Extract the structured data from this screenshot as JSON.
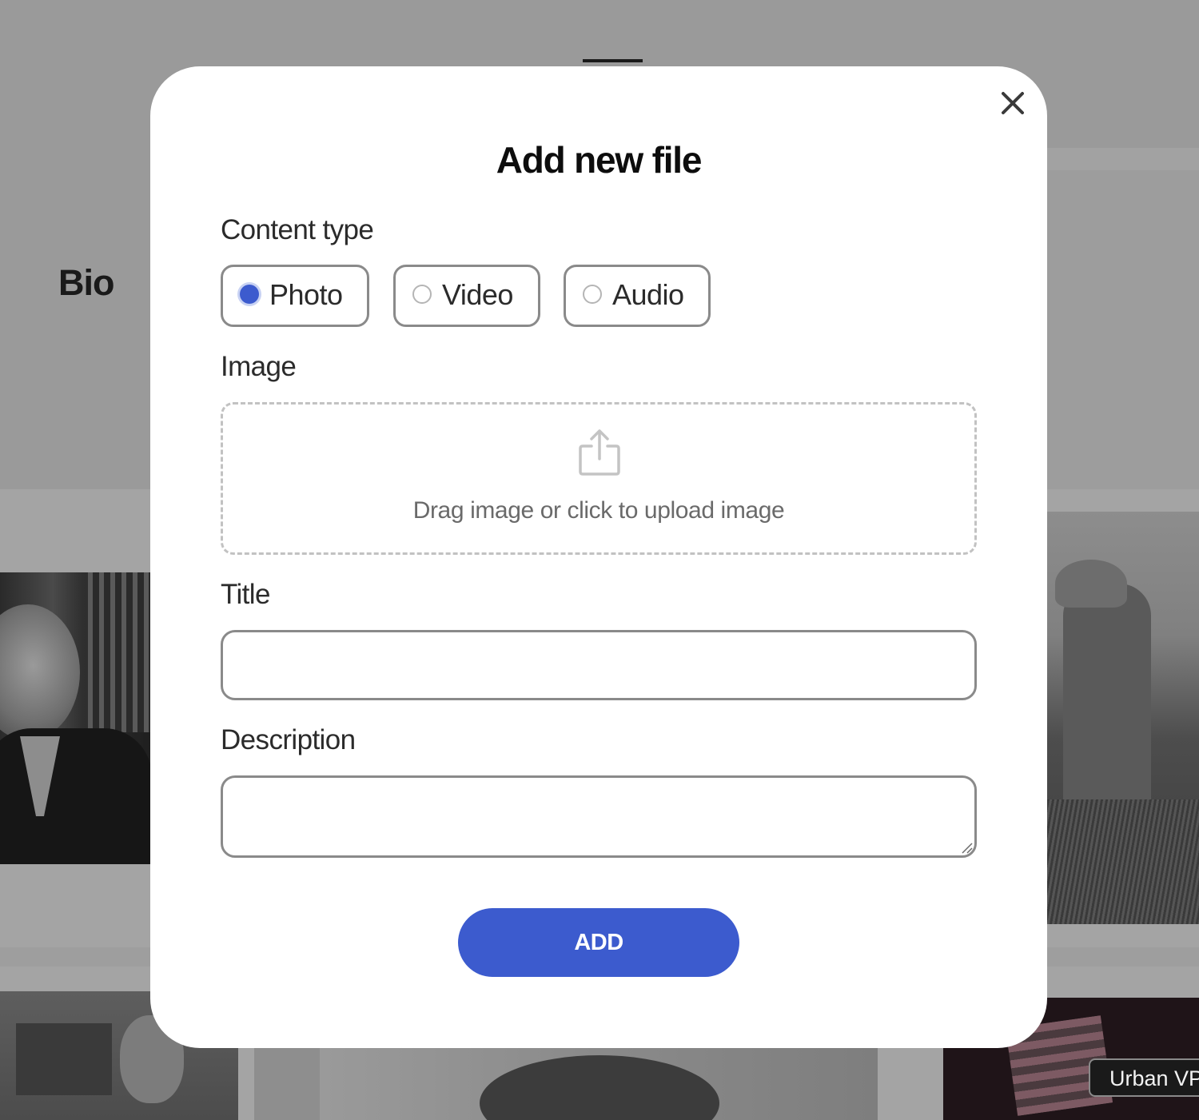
{
  "background": {
    "section_heading": "Bio",
    "photo_tag": "Urban VP"
  },
  "modal": {
    "title": "Add new file",
    "close_icon": "close-icon",
    "content_type": {
      "label": "Content type",
      "options": [
        {
          "label": "Photo",
          "selected": true
        },
        {
          "label": "Video",
          "selected": false
        },
        {
          "label": "Audio",
          "selected": false
        }
      ]
    },
    "image": {
      "label": "Image",
      "upload_icon": "upload-icon",
      "dropzone_text": "Drag image or click to upload image"
    },
    "title_field": {
      "label": "Title",
      "value": "",
      "placeholder": ""
    },
    "description_field": {
      "label": "Description",
      "value": "",
      "placeholder": ""
    },
    "submit_label": "ADD"
  },
  "colors": {
    "accent": "#3c5bce",
    "overlay": "#9a9a9a",
    "modal_bg": "#ffffff"
  }
}
